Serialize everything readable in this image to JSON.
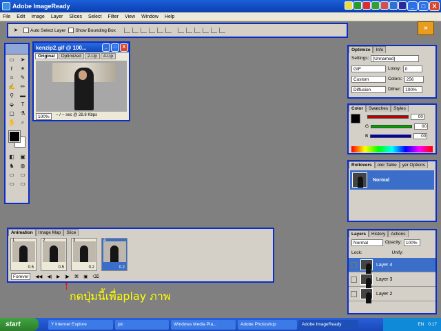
{
  "app": {
    "title": "Adobe ImageReady",
    "min": "_",
    "max": "□",
    "close": "X"
  },
  "menu": [
    "File",
    "Edit",
    "Image",
    "Layer",
    "Slices",
    "Select",
    "Filter",
    "View",
    "Window",
    "Help"
  ],
  "options_bar": {
    "auto_select": "Auto Select Layer",
    "show_bounding": "Show Bounding Box"
  },
  "document": {
    "title": "kenzip2.gif @ 100...",
    "tabs": [
      "Original",
      "Optimized",
      "2-Up",
      "4-Up"
    ],
    "zoom": "100%",
    "status": "-- / -- sec @ 28.8 Kbps"
  },
  "optimize_panel": {
    "tabs": [
      "Optimize",
      "Info"
    ],
    "settings_label": "Settings:",
    "settings_value": "[Unnamed]",
    "format": "GIF",
    "lossy_label": "Lossy:",
    "lossy_value": "0",
    "palette": "Custom",
    "colors_label": "Colors:",
    "colors_value": "256",
    "dither_mode": "Diffusion",
    "dither_label": "Dither:",
    "dither_value": "100%"
  },
  "color_panel": {
    "tabs": [
      "Color",
      "Swatches",
      "Styles"
    ],
    "channels": [
      {
        "label": "",
        "value": "00",
        "color": "#c00000"
      },
      {
        "label": "G",
        "value": "00",
        "color": "#00a000"
      },
      {
        "label": "B",
        "value": "00",
        "color": "#0000c0"
      }
    ]
  },
  "rollovers_panel": {
    "tabs": [
      "Rollovers",
      "olor Table",
      "yer Options"
    ],
    "state": "Normal"
  },
  "layers_panel": {
    "tabs": [
      "Layers",
      "History",
      "Actions"
    ],
    "blend": "Normal",
    "opacity_label": "Opacity:",
    "opacity_value": "100%",
    "lock_label": "Lock:",
    "unify_label": "Unify:",
    "layers": [
      "Layer 4",
      "Layer 3",
      "Layer 2"
    ]
  },
  "animation": {
    "tabs": [
      "Animation",
      "Image Map",
      "Slice"
    ],
    "frames": [
      {
        "num": "1",
        "delay": "0.5"
      },
      {
        "num": "2",
        "delay": "0.5"
      },
      {
        "num": "3",
        "delay": "0.2"
      },
      {
        "num": "4",
        "delay": "0.2"
      }
    ],
    "loop": "Forever"
  },
  "caption": "กดปุ่มนี้เพื่อplay ภาพ",
  "taskbar": {
    "start": "start",
    "tasks": [
      "Y Internet Explore",
      "pic",
      "Windows Media Pla...",
      "Adobe Photoshop",
      "Adobe ImageReady"
    ],
    "lang": "EN",
    "time": "0:17"
  }
}
